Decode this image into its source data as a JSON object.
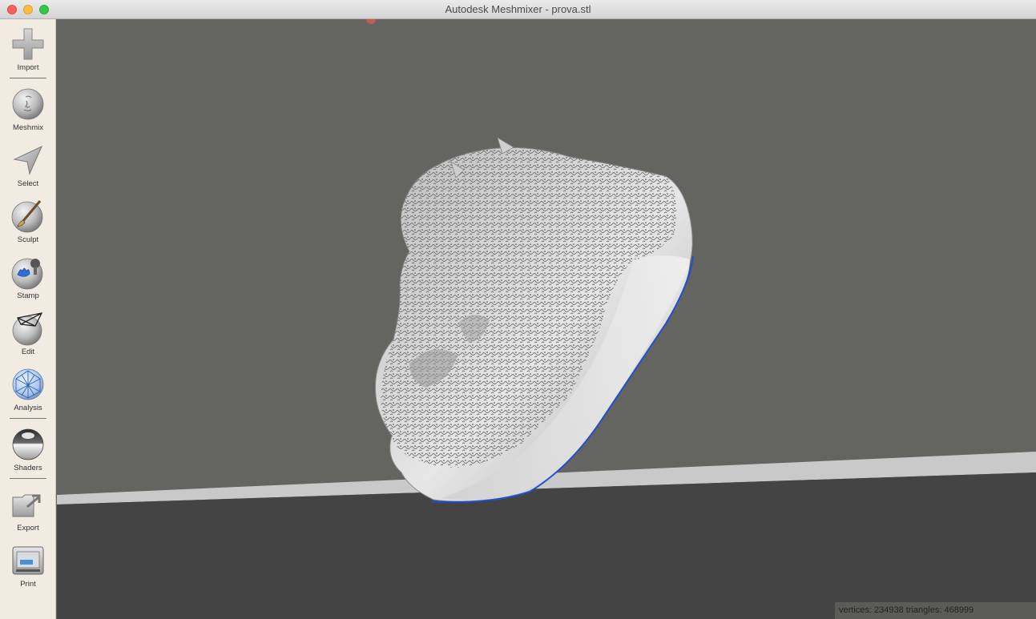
{
  "window": {
    "title": "Autodesk Meshmixer - prova.stl"
  },
  "sidebar": {
    "tools": [
      {
        "label": "Import",
        "icon": "plus-icon"
      },
      {
        "label": "Meshmix",
        "icon": "meshmix-head-icon"
      },
      {
        "label": "Select",
        "icon": "arrow-pointer-icon"
      },
      {
        "label": "Sculpt",
        "icon": "brush-sphere-icon"
      },
      {
        "label": "Stamp",
        "icon": "stamp-sphere-icon"
      },
      {
        "label": "Edit",
        "icon": "wireframe-sphere-icon"
      },
      {
        "label": "Analysis",
        "icon": "mesh-sphere-icon"
      },
      {
        "label": "Shaders",
        "icon": "chrome-sphere-icon"
      },
      {
        "label": "Export",
        "icon": "export-folder-icon"
      },
      {
        "label": "Print",
        "icon": "printer-icon"
      }
    ]
  },
  "status": {
    "text": "vertices: 234938 triangles: 468999"
  },
  "colors": {
    "viewport_background": "#646460",
    "floor": "#444444",
    "ground_plane_edge": "#c8c8c8",
    "selection_outline": "#1f4fd1",
    "sidebar_background": "#f1ebe2"
  }
}
